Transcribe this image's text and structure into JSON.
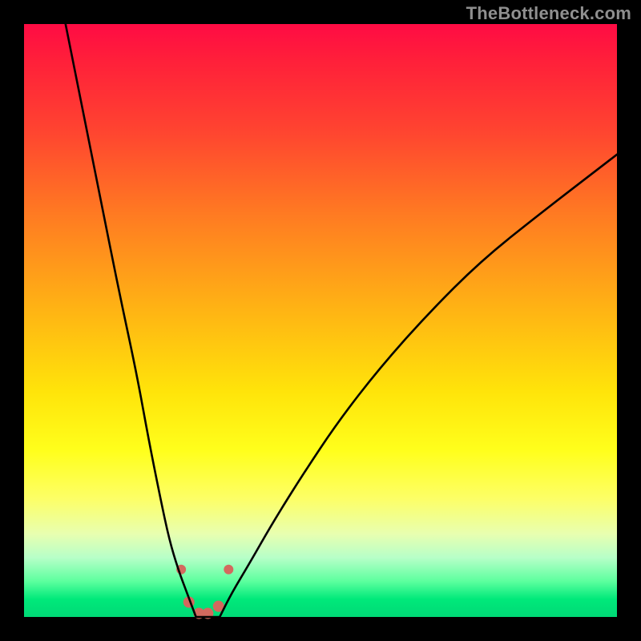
{
  "watermark": "TheBottleneck.com",
  "chart_data": {
    "type": "line",
    "title": "",
    "xlabel": "",
    "ylabel": "",
    "xlim": [
      0,
      100
    ],
    "ylim": [
      0,
      100
    ],
    "grid": false,
    "legend": false,
    "series": [
      {
        "name": "left-branch",
        "x": [
          7,
          10,
          13,
          16,
          19,
          21,
          23,
          24.5,
          26,
          27.5,
          29
        ],
        "values": [
          100,
          85,
          70,
          55,
          41,
          30,
          20,
          13,
          8,
          4,
          0
        ]
      },
      {
        "name": "right-branch",
        "x": [
          33,
          35,
          38,
          42,
          47,
          53,
          60,
          68,
          77,
          87,
          100
        ],
        "values": [
          0,
          4,
          9,
          16,
          24,
          33,
          42,
          51,
          60,
          68,
          78
        ]
      },
      {
        "name": "valley-floor",
        "x": [
          29,
          31,
          33
        ],
        "values": [
          0,
          0,
          0
        ]
      }
    ],
    "markers": {
      "series_name": "valley-markers",
      "color": "#d3695e",
      "points": [
        {
          "x": 26.5,
          "y": 8.0,
          "r": 6
        },
        {
          "x": 27.8,
          "y": 2.5,
          "r": 7
        },
        {
          "x": 29.5,
          "y": 0.6,
          "r": 7
        },
        {
          "x": 31.0,
          "y": 0.6,
          "r": 7
        },
        {
          "x": 32.8,
          "y": 1.8,
          "r": 7
        },
        {
          "x": 34.5,
          "y": 8.0,
          "r": 6
        }
      ]
    },
    "colors": {
      "curve": "#000000",
      "marker_fill": "#d3695e",
      "gradient_top": "#ff0b44",
      "gradient_bottom": "#00d976"
    }
  }
}
